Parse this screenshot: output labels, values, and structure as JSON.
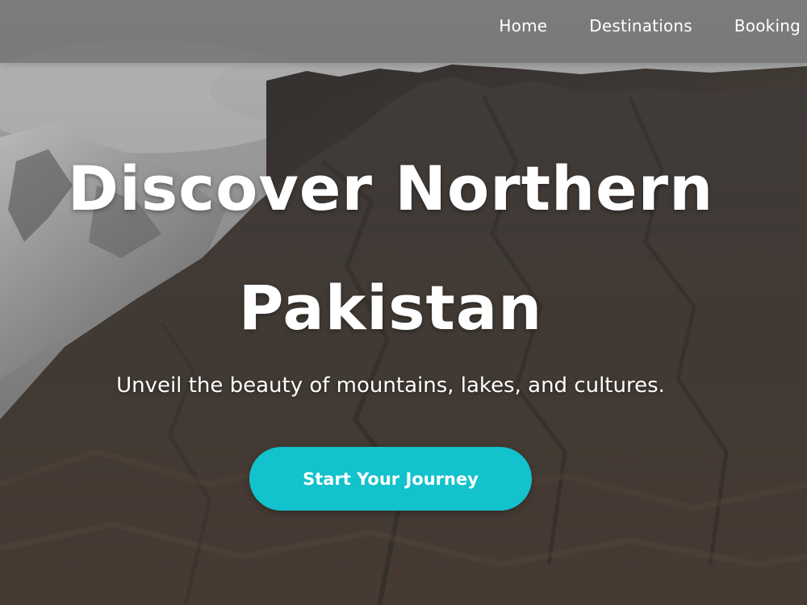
{
  "nav": {
    "items": [
      {
        "label": "Home"
      },
      {
        "label": "Destinations"
      },
      {
        "label": "Booking"
      }
    ]
  },
  "hero": {
    "title_line1": "Discover Northern",
    "title_line2": "Pakistan",
    "subtitle": "Unveil the beauty of mountains, lakes, and cultures.",
    "cta_label": "Start Your Journey",
    "background": "mountain-landscape-image"
  },
  "colors": {
    "accent": "#12c2cc",
    "navbar": "#6e6e6e",
    "text": "#ffffff"
  }
}
